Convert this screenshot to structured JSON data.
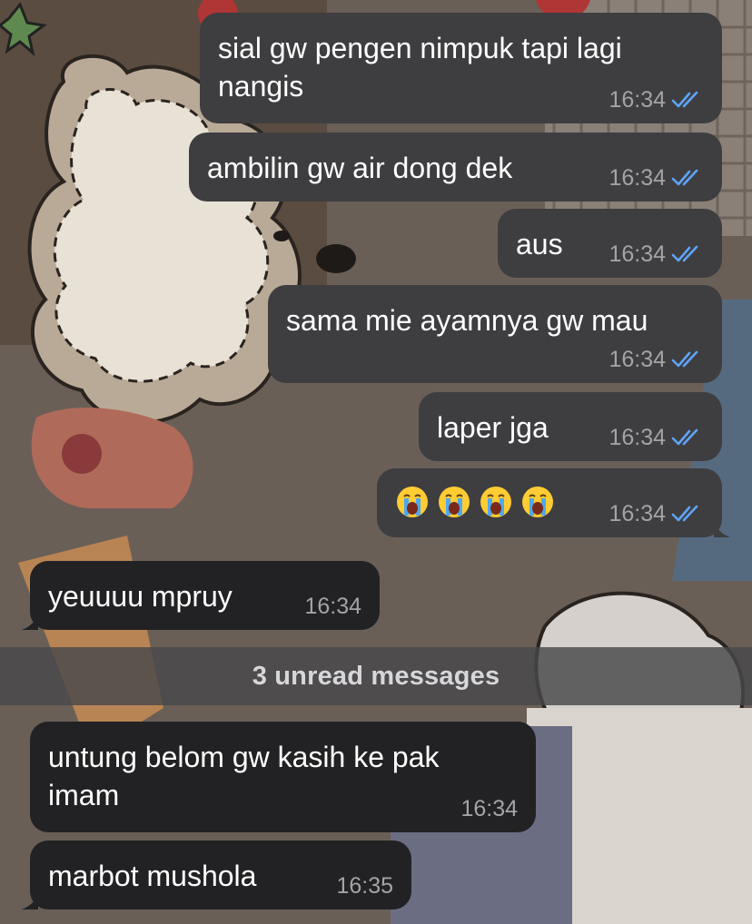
{
  "colors": {
    "outgoing_bubble": "#3e3e41",
    "incoming_bubble": "#222224",
    "read_ticks": "#5ea4f7",
    "timestamp": "#a3a3a8",
    "banner": "#48484a"
  },
  "messages": [
    {
      "direction": "outgoing",
      "lines": [
        "sial gw pengen nimpuk tapi lagi",
        "nangis"
      ],
      "time": "16:34",
      "status": "read"
    },
    {
      "direction": "outgoing",
      "lines": [
        "ambilin gw air dong dek"
      ],
      "time": "16:34",
      "status": "read"
    },
    {
      "direction": "outgoing",
      "lines": [
        "aus"
      ],
      "time": "16:34",
      "status": "read"
    },
    {
      "direction": "outgoing",
      "lines": [
        "sama mie ayamnya gw mau"
      ],
      "time": "16:34",
      "status": "read"
    },
    {
      "direction": "outgoing",
      "lines": [
        "laper jga"
      ],
      "time": "16:34",
      "status": "read"
    },
    {
      "direction": "outgoing",
      "emoji": [
        "crying-face",
        "crying-face",
        "crying-face",
        "crying-face"
      ],
      "time": "16:34",
      "status": "read"
    },
    {
      "direction": "incoming",
      "lines": [
        "yeuuuu mpruy"
      ],
      "time": "16:34"
    },
    {
      "direction": "incoming",
      "lines": [
        "untung belom gw kasih ke pak",
        "imam"
      ],
      "time": "16:34"
    },
    {
      "direction": "incoming",
      "lines": [
        "marbot mushola"
      ],
      "time": "16:35"
    }
  ],
  "unread_banner": "3 unread messages"
}
